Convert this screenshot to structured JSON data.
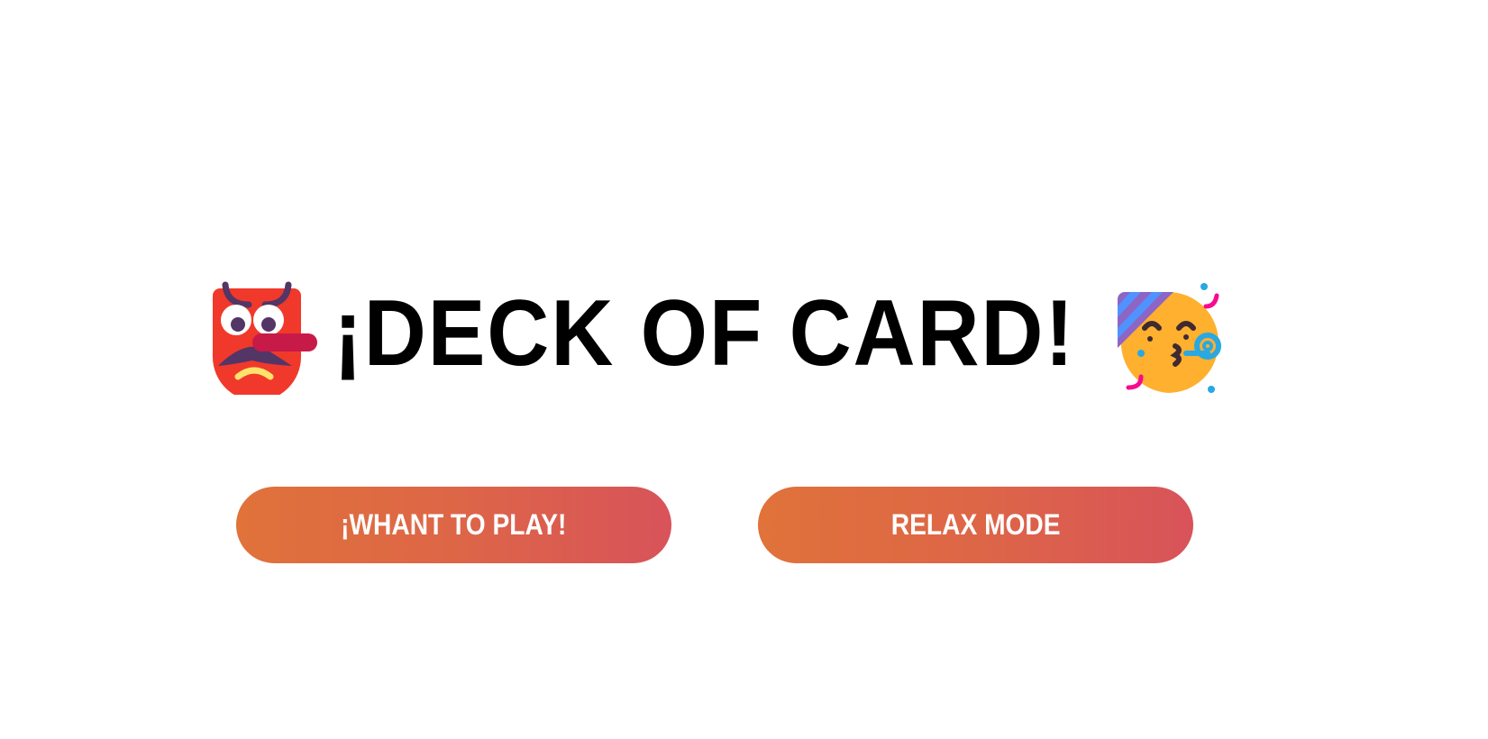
{
  "header": {
    "title": "¡DECK OF CARD!",
    "left_icon": "goblin-emoji-icon",
    "right_icon": "partying-face-emoji-icon"
  },
  "buttons": {
    "play_label": "¡WHANT TO PLAY!",
    "relax_label": "RELAX MODE"
  },
  "colors": {
    "button_gradient_start": "#E0723A",
    "button_gradient_end": "#D8535A",
    "title_color": "#000000",
    "background": "#FFFFFF"
  }
}
